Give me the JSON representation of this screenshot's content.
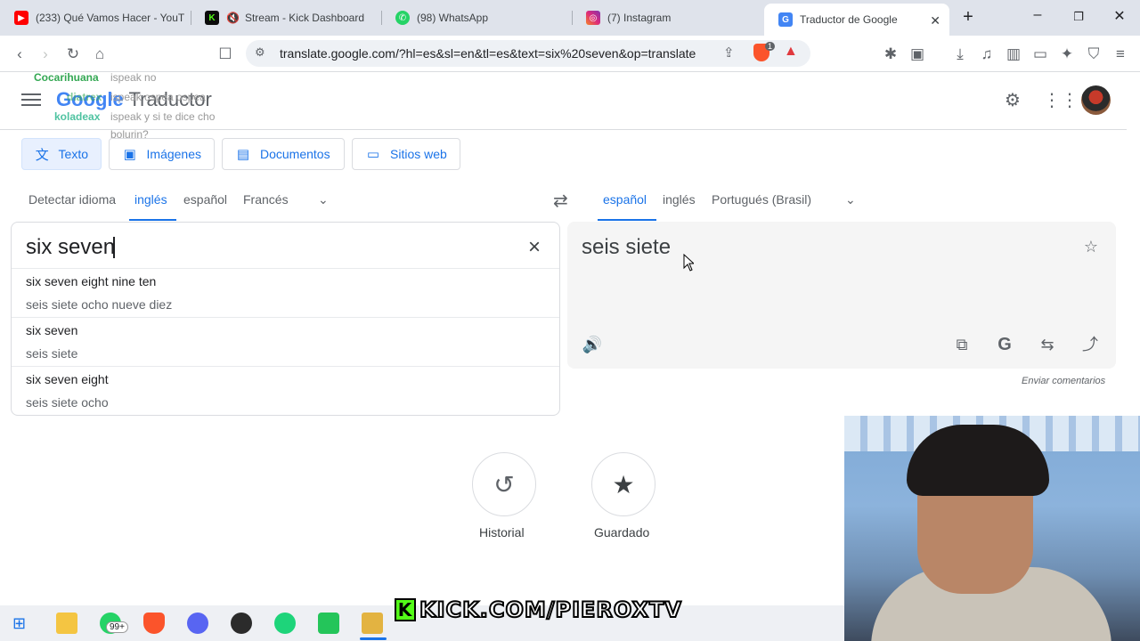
{
  "browser": {
    "tabs": [
      {
        "label": "(233) Qué Vamos Hacer - YouT",
        "icon": "youtube-icon",
        "color": "#ff0000"
      },
      {
        "label": "Stream - Kick Dashboard",
        "icon": "kick-icon",
        "color": "#53fc18"
      },
      {
        "label": "(98) WhatsApp",
        "icon": "whatsapp-icon",
        "color": "#25d366"
      },
      {
        "label": "(7) Instagram",
        "icon": "instagram-icon",
        "color": "#e1306c"
      },
      {
        "label": "Traductor de Google",
        "icon": "google-translate-icon",
        "color": "#4285f4",
        "active": true
      }
    ],
    "url": "translate.google.com/?hl=es&sl=en&tl=es&text=six%20seven&op=translate",
    "shield_badge": "1"
  },
  "header": {
    "logo_google": "Google",
    "logo_product": "Traductor",
    "overlay_chat": [
      {
        "user": "Cocarihuana",
        "message": "ispeak no",
        "user_color": "#34a853"
      },
      {
        "user": "diatrex",
        "message": "ispeak ospea ospea",
        "user_color": "#34a853"
      },
      {
        "user": "koladeax",
        "message": "ispeak y si te dice cho",
        "user_color": "#4fc3a1"
      },
      {
        "user": "",
        "message": "bolurin?",
        "user_color": "#999999"
      }
    ]
  },
  "modes": [
    {
      "label": "Texto",
      "icon": "translate-icon",
      "active": true
    },
    {
      "label": "Imágenes",
      "icon": "image-icon",
      "active": false
    },
    {
      "label": "Documentos",
      "icon": "document-icon",
      "active": false
    },
    {
      "label": "Sitios web",
      "icon": "website-icon",
      "active": false
    }
  ],
  "source_languages": [
    "Detectar idioma",
    "inglés",
    "español",
    "Francés"
  ],
  "source_selected": "inglés",
  "target_languages": [
    "español",
    "inglés",
    "Portugués (Brasil)"
  ],
  "target_selected": "español",
  "source": {
    "text": "six seven",
    "suggestions": [
      {
        "text": "six seven eight nine ten",
        "translation": "seis siete ocho nueve diez"
      },
      {
        "text": "six seven",
        "translation": "seis siete"
      },
      {
        "text": "six seven eight",
        "translation": "seis siete ocho"
      }
    ]
  },
  "target": {
    "text": "seis siete",
    "feedback": "Enviar comentarios"
  },
  "bottom": {
    "history_label": "Historial",
    "saved_label": "Guardado"
  },
  "taskbar": {
    "whatsapp_badge": "99+",
    "watermark": "KICK.COM/PIEROXTV"
  }
}
